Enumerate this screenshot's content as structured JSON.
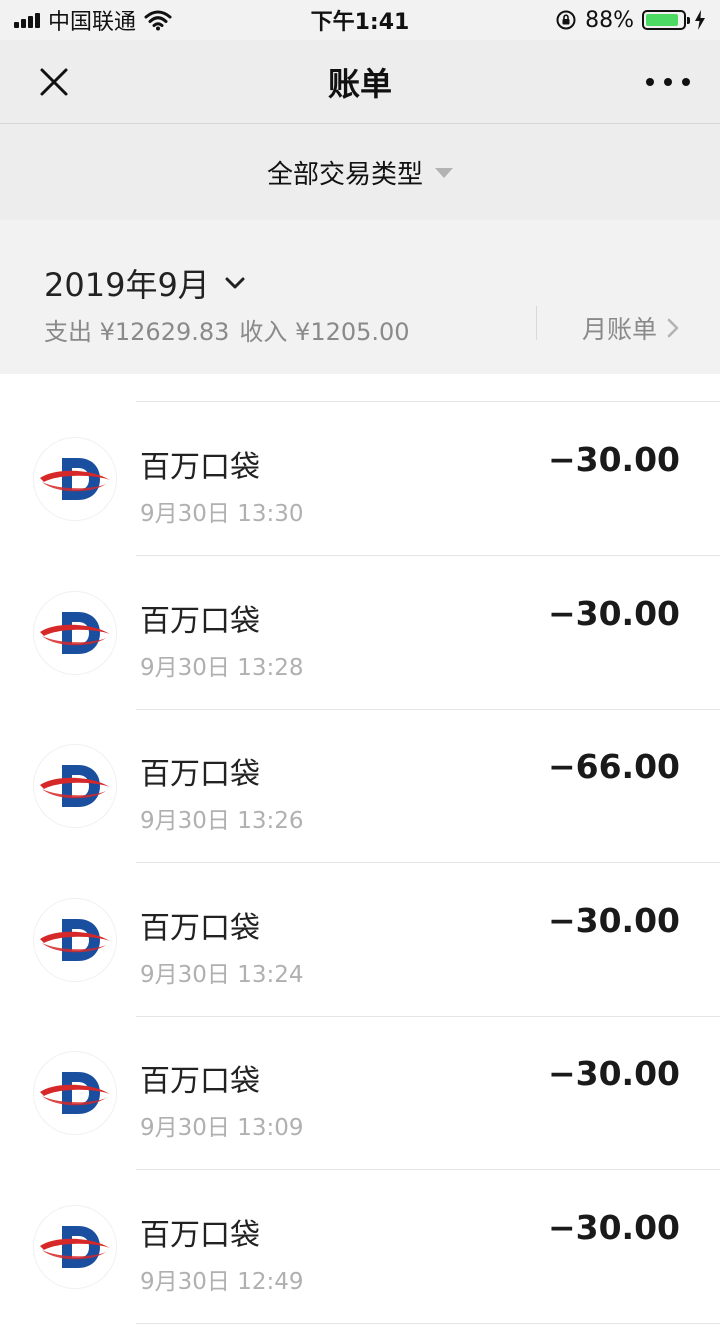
{
  "status_bar": {
    "carrier": "中国联通",
    "time": "下午1:41",
    "battery_percent": "88%",
    "battery_level": 0.88,
    "signal_icon": "signal-bars-icon",
    "wifi_icon": "wifi-icon",
    "rotation_lock_icon": "rotation-lock-icon",
    "charging_icon": "charging-bolt-icon"
  },
  "navbar": {
    "title": "账单",
    "close_icon": "close-icon",
    "more_icon": "more-dots-icon"
  },
  "filter": {
    "label": "全部交易类型",
    "icon": "triangle-down-icon"
  },
  "month": {
    "title": "2019年9月",
    "expense_text": "支出 ¥12629.83",
    "income_text": "收入 ¥1205.00",
    "bill_link": "月账单",
    "title_icon": "chevron-down-icon",
    "link_icon": "chevron-right-icon"
  },
  "colors": {
    "background": "#ededed",
    "logo_blue": "#1a4fa0",
    "logo_red": "#d62828",
    "battery_green": "#4cd964"
  },
  "transactions": [
    {
      "merchant": "百万口袋",
      "time": "9月30日 13:30",
      "amount": "−30.00"
    },
    {
      "merchant": "百万口袋",
      "time": "9月30日 13:28",
      "amount": "−30.00"
    },
    {
      "merchant": "百万口袋",
      "time": "9月30日 13:26",
      "amount": "−66.00"
    },
    {
      "merchant": "百万口袋",
      "time": "9月30日 13:24",
      "amount": "−30.00"
    },
    {
      "merchant": "百万口袋",
      "time": "9月30日 13:09",
      "amount": "−30.00"
    },
    {
      "merchant": "百万口袋",
      "time": "9月30日 12:49",
      "amount": "−30.00"
    }
  ]
}
